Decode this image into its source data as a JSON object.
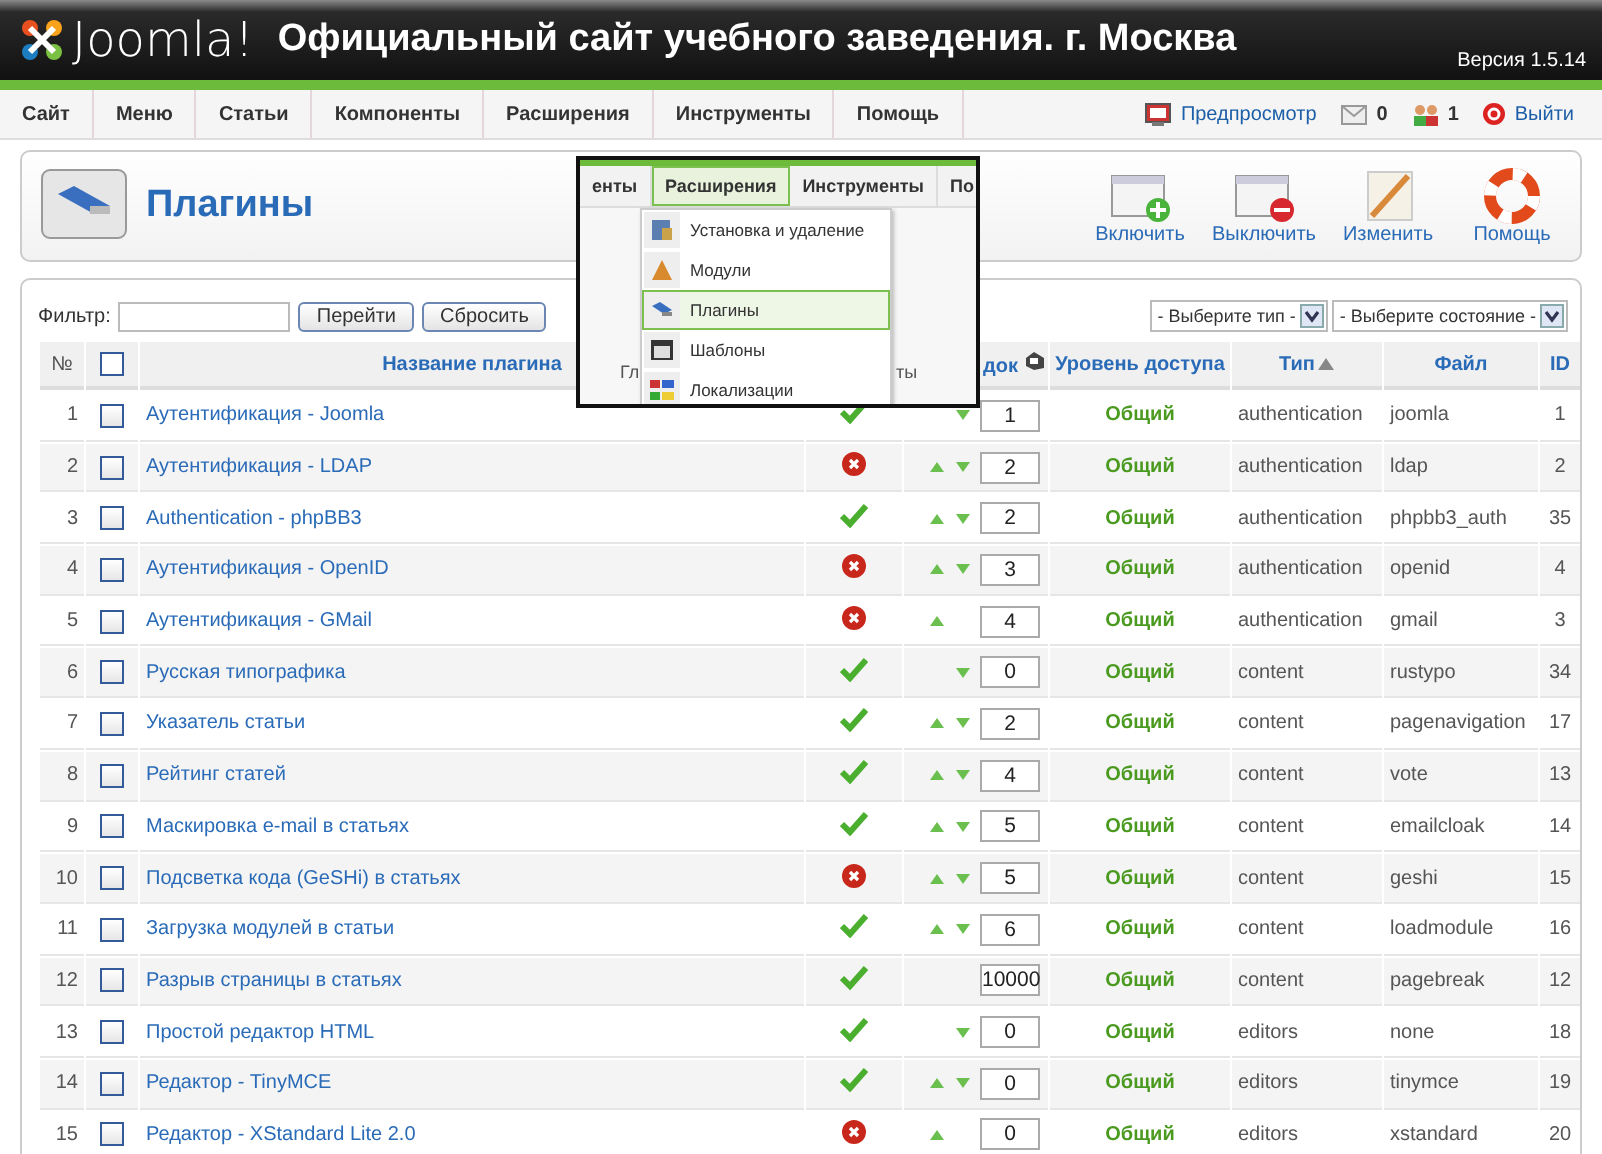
{
  "header": {
    "logo": "Joomla!",
    "site_title": "Официальный сайт учебного заведения. г. Москва",
    "version": "Версия 1.5.14"
  },
  "menu": [
    {
      "label": "Сайт"
    },
    {
      "label": "Меню"
    },
    {
      "label": "Статьи"
    },
    {
      "label": "Компоненты"
    },
    {
      "label": "Расширения"
    },
    {
      "label": "Инструменты"
    },
    {
      "label": "Помощь"
    }
  ],
  "status": {
    "preview": "Предпросмотр",
    "messages": "0",
    "users": "1",
    "logout": "Выйти"
  },
  "toolbar": {
    "title": "Плагины",
    "buttons": [
      {
        "kind": "enable",
        "label": "Включить"
      },
      {
        "kind": "disable",
        "label": "Выключить"
      },
      {
        "kind": "edit",
        "label": "Изменить"
      },
      {
        "kind": "help",
        "label": "Помощь"
      }
    ]
  },
  "inset": {
    "tabs": [
      {
        "label": "енты",
        "selected": false
      },
      {
        "label": "Расширения",
        "selected": true
      },
      {
        "label": "Инструменты",
        "selected": false
      },
      {
        "label": "По",
        "selected": false
      }
    ],
    "items": [
      {
        "kind": "install",
        "label": "Установка и удаление",
        "selected": false
      },
      {
        "kind": "modules",
        "label": "Модули",
        "selected": false
      },
      {
        "kind": "plugins",
        "label": "Плагины",
        "selected": true
      },
      {
        "kind": "templates",
        "label": "Шаблоны",
        "selected": false
      },
      {
        "kind": "languages",
        "label": "Локализации",
        "selected": false
      }
    ],
    "behind_texts": [
      "Гл",
      "ты"
    ]
  },
  "filter": {
    "label": "Фильтр:",
    "go": "Перейти",
    "reset": "Сбросить",
    "type_select": "- Выберите тип -",
    "state_select": "- Выберите состояние -"
  },
  "table": {
    "select_all_checked": false,
    "columns": [
      "№",
      "Название плагина",
      "док",
      "Уровень доступа",
      "Тип",
      "Файл",
      "ID"
    ],
    "rows": [
      {
        "num": "1",
        "checked": false,
        "name": "Аутентификация - Joomla",
        "enabled": true,
        "up": false,
        "down": true,
        "order": "1",
        "access": "Общий",
        "type": "authentication",
        "file": "joomla",
        "id": "1"
      },
      {
        "num": "2",
        "checked": false,
        "name": "Аутентификация - LDAP",
        "enabled": false,
        "up": true,
        "down": true,
        "order": "2",
        "access": "Общий",
        "type": "authentication",
        "file": "ldap",
        "id": "2"
      },
      {
        "num": "3",
        "checked": false,
        "name": "Authentication - phpBB3",
        "enabled": true,
        "up": true,
        "down": true,
        "order": "2",
        "access": "Общий",
        "type": "authentication",
        "file": "phpbb3_auth",
        "id": "35"
      },
      {
        "num": "4",
        "checked": false,
        "name": "Аутентификация - OpenID",
        "enabled": false,
        "up": true,
        "down": true,
        "order": "3",
        "access": "Общий",
        "type": "authentication",
        "file": "openid",
        "id": "4"
      },
      {
        "num": "5",
        "checked": false,
        "name": "Аутентификация - GMail",
        "enabled": false,
        "up": true,
        "down": false,
        "order": "4",
        "access": "Общий",
        "type": "authentication",
        "file": "gmail",
        "id": "3"
      },
      {
        "num": "6",
        "checked": false,
        "name": "Русская типографика",
        "enabled": true,
        "up": false,
        "down": true,
        "order": "0",
        "access": "Общий",
        "type": "content",
        "file": "rustypo",
        "id": "34"
      },
      {
        "num": "7",
        "checked": false,
        "name": "Указатель статьи",
        "enabled": true,
        "up": true,
        "down": true,
        "order": "2",
        "access": "Общий",
        "type": "content",
        "file": "pagenavigation",
        "id": "17"
      },
      {
        "num": "8",
        "checked": false,
        "name": "Рейтинг статей",
        "enabled": true,
        "up": true,
        "down": true,
        "order": "4",
        "access": "Общий",
        "type": "content",
        "file": "vote",
        "id": "13"
      },
      {
        "num": "9",
        "checked": false,
        "name": "Маскировка e-mail в статьях",
        "enabled": true,
        "up": true,
        "down": true,
        "order": "5",
        "access": "Общий",
        "type": "content",
        "file": "emailcloak",
        "id": "14"
      },
      {
        "num": "10",
        "checked": false,
        "name": "Подсветка кода (GeSHi) в статьях",
        "enabled": false,
        "up": true,
        "down": true,
        "order": "5",
        "access": "Общий",
        "type": "content",
        "file": "geshi",
        "id": "15"
      },
      {
        "num": "11",
        "checked": false,
        "name": "Загрузка модулей в статьи",
        "enabled": true,
        "up": true,
        "down": true,
        "order": "6",
        "access": "Общий",
        "type": "content",
        "file": "loadmodule",
        "id": "16"
      },
      {
        "num": "12",
        "checked": false,
        "name": "Разрыв страницы в статьях",
        "enabled": true,
        "up": false,
        "down": false,
        "order": "10000",
        "access": "Общий",
        "type": "content",
        "file": "pagebreak",
        "id": "12"
      },
      {
        "num": "13",
        "checked": false,
        "name": "Простой редактор HTML",
        "enabled": true,
        "up": false,
        "down": true,
        "order": "0",
        "access": "Общий",
        "type": "editors",
        "file": "none",
        "id": "18"
      },
      {
        "num": "14",
        "checked": false,
        "name": "Редактор - TinyMCE",
        "enabled": true,
        "up": true,
        "down": true,
        "order": "0",
        "access": "Общий",
        "type": "editors",
        "file": "tinymce",
        "id": "19"
      },
      {
        "num": "15",
        "checked": false,
        "name": "Редактор - XStandard Lite 2.0",
        "enabled": false,
        "up": true,
        "down": false,
        "order": "0",
        "access": "Общий",
        "type": "editors",
        "file": "xstandard",
        "id": "20"
      }
    ]
  }
}
